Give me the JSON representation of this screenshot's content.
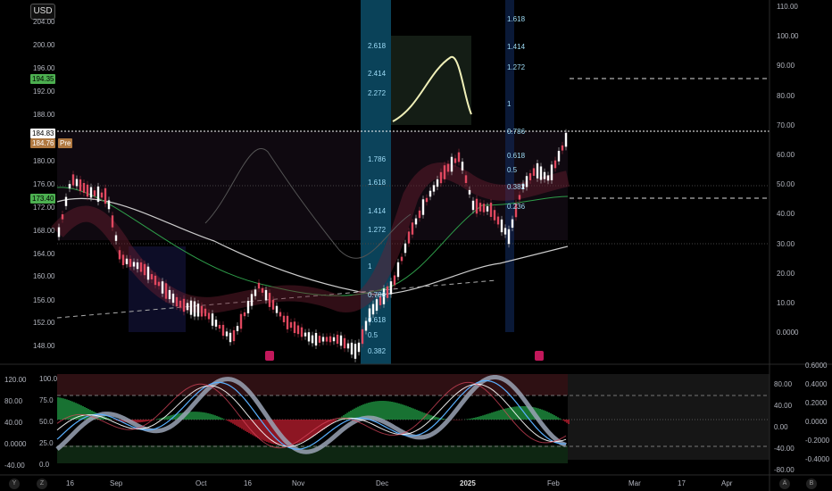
{
  "currency": "USD",
  "price_axis_left": [
    "204.00",
    "200.00",
    "196.00",
    "192.00",
    "188.00",
    "180.00",
    "176.00",
    "172.00",
    "168.00",
    "164.00",
    "160.00",
    "156.00",
    "152.00",
    "148.00"
  ],
  "price_tags": [
    {
      "label": "194.35",
      "bg": "#4caf50",
      "fg": "#000"
    },
    {
      "label": "184.83",
      "bg": "#ffffff",
      "fg": "#000"
    },
    {
      "label": "184.76",
      "bg": "#b07840",
      "fg": "#fff"
    },
    {
      "label": "Pre",
      "bg": "#b07840",
      "fg": "#fff"
    },
    {
      "label": "173.40",
      "bg": "#4caf50",
      "fg": "#000"
    }
  ],
  "right_axis": [
    "110.00",
    "100.00",
    "90.00",
    "80.00",
    "70.00",
    "60.00",
    "50.00",
    "40.00",
    "30.00",
    "20.00",
    "10.00",
    "0.0000"
  ],
  "fib_levels_a": [
    "2.618",
    "2.414",
    "2.272",
    "1.786",
    "1.618",
    "1.414",
    "1.272",
    "1",
    "0.786",
    "0.618",
    "0.5",
    "0.382"
  ],
  "fib_levels_b": [
    "1.618",
    "1.414",
    "1.272",
    "1",
    "0.786",
    "0.618",
    "0.5",
    "0.382",
    "0.236"
  ],
  "oscillator_left_a": [
    "120.00",
    "80.00",
    "40.00",
    "0.0000",
    "-40.00"
  ],
  "oscillator_left_b": [
    "100.0",
    "75.0",
    "50.0",
    "25.0",
    "0.0"
  ],
  "oscillator_right_a": [
    "80.00",
    "40.00",
    "0.00",
    "-40.00",
    "-80.00"
  ],
  "oscillator_right_b": [
    "0.6000",
    "0.4000",
    "0.2000",
    "0.0000",
    "-0.2000",
    "-0.4000"
  ],
  "time_axis": [
    "16",
    "Sep",
    "Oct",
    "16",
    "Nov",
    "Dec",
    "2025",
    "Feb",
    "Mar",
    "17",
    "Apr"
  ],
  "bottom_corners": [
    "Y",
    "Z",
    "A",
    "B"
  ],
  "colors": {
    "up": "#ffffff",
    "down": "#e0485f",
    "ema_green": "#2e9e4a",
    "fib_box": "#0e5a78",
    "accent": "#4caf50"
  }
}
